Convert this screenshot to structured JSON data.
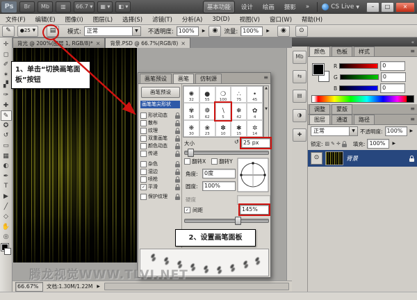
{
  "colors": {
    "annotation_red": "#cf1310",
    "selection_blue": "#2e59a8",
    "layer_select_navy": "#27477e",
    "canvas_olive": "#8a8a1c"
  },
  "titlebar": {
    "logo": "Ps",
    "bridge_icon": "Br",
    "mini_bridge_icon": "Mb",
    "view_extras_icon": "▥",
    "zoom_value": "66.7",
    "arrange_icon": "▦",
    "screen_mode_icon": "◧",
    "dropdown_arrow": "▼",
    "workspaces": [
      "基本功能",
      "设计",
      "绘画",
      "摄影"
    ],
    "overflow": "»",
    "cs_live": "CS Live",
    "window": {
      "minimize": "–",
      "maximize": "□",
      "close": "×"
    }
  },
  "menubar": {
    "items": [
      "文件(F)",
      "编辑(E)",
      "图像(I)",
      "图层(L)",
      "选择(S)",
      "滤镜(T)",
      "分析(A)",
      "3D(D)",
      "视图(V)",
      "窗口(W)",
      "帮助(H)"
    ]
  },
  "optionsbar": {
    "brush_tool_icon": "✎",
    "preset_size": "25",
    "toggle_panel_icon": "▤",
    "mode_label": "模式:",
    "mode_value": "正常",
    "opacity_label": "不透明度:",
    "opacity_value": "100%",
    "airbrush_icon": "◉",
    "flow_label": "流量:",
    "flow_value": "100%",
    "tablet_icon": "⊙"
  },
  "doc_tabs": [
    {
      "title": "背光 @ 200%(图层 1, RGB/8)*",
      "close": "×"
    },
    {
      "title": "背景.PSD @ 66.7%(RGB/8)",
      "close": "×"
    }
  ],
  "tools": [
    {
      "name": "move-tool",
      "glyph": "✛"
    },
    {
      "name": "marquee-tool",
      "glyph": "◻"
    },
    {
      "name": "lasso-tool",
      "glyph": "✐"
    },
    {
      "name": "quick-selection-tool",
      "glyph": "✶"
    },
    {
      "name": "crop-tool",
      "glyph": "▞"
    },
    {
      "name": "eyedropper-tool",
      "glyph": "✑"
    },
    {
      "name": "healing-brush-tool",
      "glyph": "✚"
    },
    {
      "name": "brush-tool",
      "glyph": "✎"
    },
    {
      "name": "clone-stamp-tool",
      "glyph": "✪"
    },
    {
      "name": "history-brush-tool",
      "glyph": "↺"
    },
    {
      "name": "eraser-tool",
      "glyph": "▭"
    },
    {
      "name": "gradient-tool",
      "glyph": "▦"
    },
    {
      "name": "dodge-tool",
      "glyph": "◐"
    },
    {
      "name": "pen-tool",
      "glyph": "✒"
    },
    {
      "name": "type-tool",
      "glyph": "T"
    },
    {
      "name": "path-selection-tool",
      "glyph": "▶"
    },
    {
      "name": "line-tool",
      "glyph": "╱"
    },
    {
      "name": "3d-rotate-tool",
      "glyph": "◇"
    },
    {
      "name": "hand-tool",
      "glyph": "✋"
    },
    {
      "name": "zoom-tool",
      "glyph": "◎"
    }
  ],
  "callouts": {
    "step1": "1、单击“切换画笔面板”按钮",
    "step2": "2、设置画笔面板"
  },
  "brush_panel": {
    "tabs": [
      "画笔预设",
      "画笔",
      "仿制源"
    ],
    "panel_menu_icon": "≡",
    "preset_button": "画笔预设",
    "tip_shape_item": "画笔笔尖形状",
    "options": [
      {
        "label": "形状动态",
        "check": ""
      },
      {
        "label": "散布",
        "check": ""
      },
      {
        "label": "纹理",
        "check": ""
      },
      {
        "label": "双重画笔",
        "check": ""
      },
      {
        "label": "颜色动态",
        "check": ""
      },
      {
        "label": "传递",
        "check": ""
      },
      {
        "label": "杂色",
        "check": ""
      },
      {
        "label": "湿边",
        "check": ""
      },
      {
        "label": "喷枪",
        "check": ""
      },
      {
        "label": "平滑",
        "check": "✓"
      },
      {
        "label": "保护纹理",
        "check": ""
      }
    ],
    "tips": [
      {
        "glyph": "✺",
        "size": "32"
      },
      {
        "glyph": "●",
        "size": "55"
      },
      {
        "glyph": "❍",
        "size": "100"
      },
      {
        "glyph": "∴",
        "size": "75"
      },
      {
        "glyph": "•",
        "size": "45"
      },
      {
        "glyph": "✾",
        "size": "36"
      },
      {
        "glyph": "❁",
        "size": "62"
      },
      {
        "glyph": "∖",
        "size": "5"
      },
      {
        "glyph": "❅",
        "size": "42"
      },
      {
        "glyph": "✿",
        "size": "4"
      },
      {
        "glyph": "❋",
        "size": "30"
      },
      {
        "glyph": "❀",
        "size": "23"
      },
      {
        "glyph": "✽",
        "size": "10"
      },
      {
        "glyph": "✱",
        "size": "15"
      },
      {
        "glyph": "✲",
        "size": "14"
      }
    ],
    "scroll_up": "▲",
    "scroll_down": "▼",
    "size_label": "大小",
    "size_value": "25 px",
    "reset_icon": "↺",
    "flip_x_label": "翻转X",
    "flip_y_label": "翻转Y",
    "flip_x_check": "",
    "flip_y_check": "",
    "angle_label": "角度:",
    "angle_value": "0度",
    "roundness_label": "圆度:",
    "roundness_value": "100%",
    "hardness_label": "硬度",
    "spacing_label": "间距",
    "spacing_check": "✓",
    "spacing_value": "145%"
  },
  "dock": {
    "collapse_icon": "«",
    "icons": [
      {
        "name": "mini-bridge-icon",
        "glyph": "Mb"
      },
      {
        "name": "actions-icon",
        "glyph": "⇆"
      },
      {
        "name": "histogram-icon",
        "glyph": "▤"
      },
      {
        "name": "info-icon",
        "glyph": "◑"
      },
      {
        "name": "clone-source-icon",
        "glyph": "✚"
      }
    ]
  },
  "color_panel": {
    "tabs": [
      "颜色",
      "色板",
      "样式"
    ],
    "panel_menu_icon": "≡",
    "sliders": [
      {
        "channel": "R",
        "value": "0"
      },
      {
        "channel": "G",
        "value": "0"
      },
      {
        "channel": "B",
        "value": "0"
      }
    ]
  },
  "adjust_group": {
    "tabs": [
      "调整",
      "蒙版"
    ],
    "panel_menu_icon": "≡"
  },
  "layers_panel": {
    "tabs": [
      "图层",
      "通道",
      "路径"
    ],
    "panel_menu_icon": "≡",
    "blend_value": "正常",
    "dropdown_arrow": "▼",
    "opacity_label": "不透明度:",
    "opacity_value": "100%",
    "lock_label": "锁定:",
    "lock_icons": [
      "▨",
      "✎",
      "✛"
    ],
    "fill_label": "填充:",
    "fill_value": "100%",
    "layer": {
      "eye_icon": "⊙",
      "name": "背景"
    }
  },
  "statusbar": {
    "zoom": "66.67%",
    "doc_info": "文档:1.30M/1.22M",
    "arrow": "▶"
  },
  "watermark": "腾龙视觉WWW.TLVI.NET"
}
